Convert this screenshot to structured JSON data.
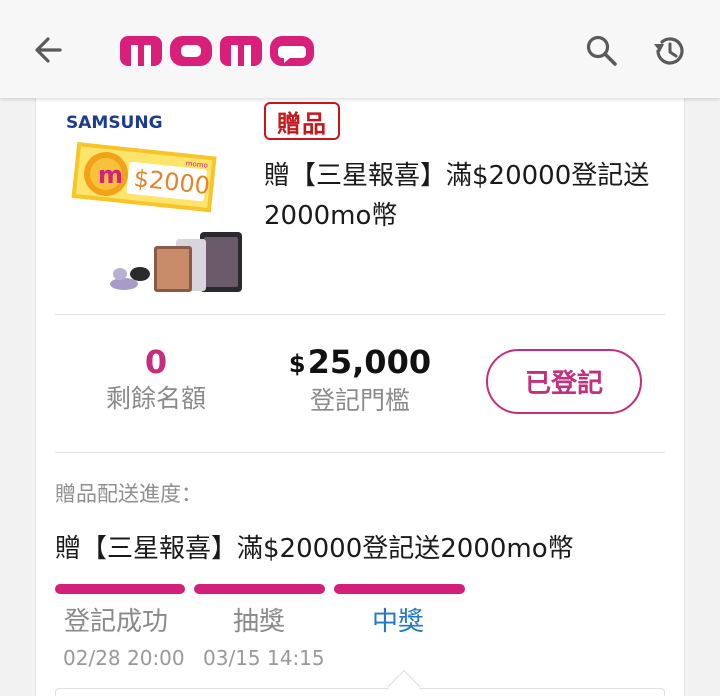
{
  "header": {
    "back_icon": "arrow-left-icon",
    "logo_text": "momo",
    "search_icon": "search-icon",
    "history_icon": "history-icon",
    "brand_color": "#d81f7a"
  },
  "gift": {
    "image": {
      "brand": "SAMSUNG",
      "coin_label": "$2000",
      "coin_letter": "m",
      "tag_text": "momo"
    },
    "badge": "贈品",
    "title": "贈【三星報喜】滿$20000登記送2000mo幣"
  },
  "stats": {
    "remaining_value": "0",
    "remaining_label": "剩餘名額",
    "threshold_currency": "$",
    "threshold_value": "25,000",
    "threshold_label": "登記門檻"
  },
  "register_button": "已登記",
  "progress": {
    "title": "贈品配送進度：",
    "item_title": "贈【三星報喜】滿$20000登記送2000mo幣",
    "steps": [
      {
        "label": "登記成功",
        "date": "02/28 20:00"
      },
      {
        "label": "抽獎",
        "date": "03/15 14:15"
      },
      {
        "label": "中獎",
        "date": ""
      }
    ],
    "bar_color": "#d11f7a",
    "active_color": "#1f78c8"
  }
}
